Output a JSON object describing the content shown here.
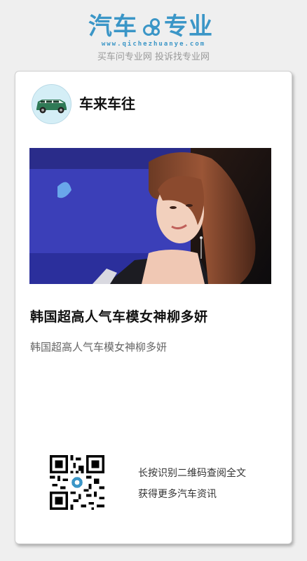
{
  "header": {
    "logo_left": "汽车",
    "logo_right": "专业",
    "logo_url": "www.qichezhuanye.com",
    "tagline": "买车问专业网 投诉找专业网"
  },
  "account": {
    "name": "车来车往",
    "avatar_icon": "car-icon"
  },
  "article": {
    "title": "韩国超高人气车模女神柳多妍",
    "description": "韩国超高人气车模女神柳多妍",
    "image_icon": "photo-icon"
  },
  "qr": {
    "line1": "长按识别二维码查阅全文",
    "line2": "获得更多汽车资讯"
  },
  "colors": {
    "brand": "#3b96c7",
    "background": "#efefef",
    "card": "#ffffff"
  }
}
